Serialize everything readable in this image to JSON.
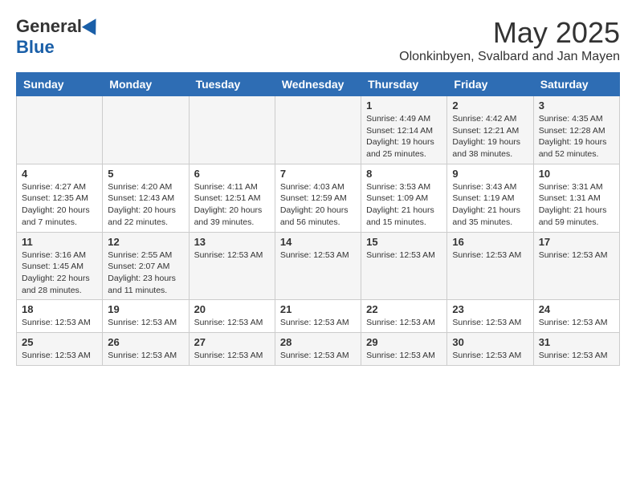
{
  "logo": {
    "general": "General",
    "blue": "Blue"
  },
  "header": {
    "month": "May 2025",
    "subtitle": "Olonkinbyen, Svalbard and Jan Mayen"
  },
  "days_of_week": [
    "Sunday",
    "Monday",
    "Tuesday",
    "Wednesday",
    "Thursday",
    "Friday",
    "Saturday"
  ],
  "weeks": [
    [
      {
        "day": "",
        "info": ""
      },
      {
        "day": "",
        "info": ""
      },
      {
        "day": "",
        "info": ""
      },
      {
        "day": "",
        "info": ""
      },
      {
        "day": "1",
        "info": "Sunrise: 4:49 AM\nSunset: 12:14 AM\nDaylight: 19 hours and 25 minutes."
      },
      {
        "day": "2",
        "info": "Sunrise: 4:42 AM\nSunset: 12:21 AM\nDaylight: 19 hours and 38 minutes."
      },
      {
        "day": "3",
        "info": "Sunrise: 4:35 AM\nSunset: 12:28 AM\nDaylight: 19 hours and 52 minutes."
      }
    ],
    [
      {
        "day": "4",
        "info": "Sunrise: 4:27 AM\nSunset: 12:35 AM\nDaylight: 20 hours and 7 minutes."
      },
      {
        "day": "5",
        "info": "Sunrise: 4:20 AM\nSunset: 12:43 AM\nDaylight: 20 hours and 22 minutes."
      },
      {
        "day": "6",
        "info": "Sunrise: 4:11 AM\nSunset: 12:51 AM\nDaylight: 20 hours and 39 minutes."
      },
      {
        "day": "7",
        "info": "Sunrise: 4:03 AM\nSunset: 12:59 AM\nDaylight: 20 hours and 56 minutes."
      },
      {
        "day": "8",
        "info": "Sunrise: 3:53 AM\nSunset: 1:09 AM\nDaylight: 21 hours and 15 minutes."
      },
      {
        "day": "9",
        "info": "Sunrise: 3:43 AM\nSunset: 1:19 AM\nDaylight: 21 hours and 35 minutes."
      },
      {
        "day": "10",
        "info": "Sunrise: 3:31 AM\nSunset: 1:31 AM\nDaylight: 21 hours and 59 minutes."
      }
    ],
    [
      {
        "day": "11",
        "info": "Sunrise: 3:16 AM\nSunset: 1:45 AM\nDaylight: 22 hours and 28 minutes."
      },
      {
        "day": "12",
        "info": "Sunrise: 2:55 AM\nSunset: 2:07 AM\nDaylight: 23 hours and 11 minutes."
      },
      {
        "day": "13",
        "info": "Sunrise: 12:53 AM"
      },
      {
        "day": "14",
        "info": "Sunrise: 12:53 AM"
      },
      {
        "day": "15",
        "info": "Sunrise: 12:53 AM"
      },
      {
        "day": "16",
        "info": "Sunrise: 12:53 AM"
      },
      {
        "day": "17",
        "info": "Sunrise: 12:53 AM"
      }
    ],
    [
      {
        "day": "18",
        "info": "Sunrise: 12:53 AM"
      },
      {
        "day": "19",
        "info": "Sunrise: 12:53 AM"
      },
      {
        "day": "20",
        "info": "Sunrise: 12:53 AM"
      },
      {
        "day": "21",
        "info": "Sunrise: 12:53 AM"
      },
      {
        "day": "22",
        "info": "Sunrise: 12:53 AM"
      },
      {
        "day": "23",
        "info": "Sunrise: 12:53 AM"
      },
      {
        "day": "24",
        "info": "Sunrise: 12:53 AM"
      }
    ],
    [
      {
        "day": "25",
        "info": "Sunrise: 12:53 AM"
      },
      {
        "day": "26",
        "info": "Sunrise: 12:53 AM"
      },
      {
        "day": "27",
        "info": "Sunrise: 12:53 AM"
      },
      {
        "day": "28",
        "info": "Sunrise: 12:53 AM"
      },
      {
        "day": "29",
        "info": "Sunrise: 12:53 AM"
      },
      {
        "day": "30",
        "info": "Sunrise: 12:53 AM"
      },
      {
        "day": "31",
        "info": "Sunrise: 12:53 AM"
      }
    ]
  ]
}
